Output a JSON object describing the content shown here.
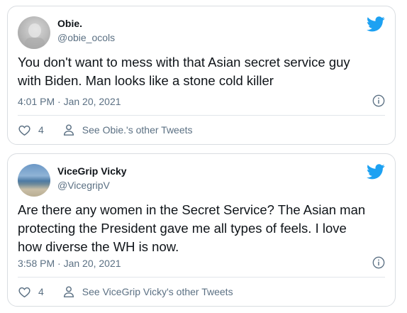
{
  "colors": {
    "twitter_blue": "#1da1f2",
    "secondary_text": "#5b7083",
    "border": "#d9dde1"
  },
  "tweets": [
    {
      "name": "Obie.",
      "handle": "@obie_ocols",
      "text": "You don't want to mess with that Asian secret service guy\nwith Biden. Man looks like a stone cold killer",
      "time": "4:01 PM · Jan 20, 2021",
      "likes": "4",
      "profile_link": "See Obie.'s other Tweets",
      "icons": {
        "brand": "twitter-bird-icon",
        "info": "info-icon",
        "like": "heart-icon",
        "profile": "person-icon"
      }
    },
    {
      "name": "ViceGrip Vicky",
      "handle": "@VicegripV",
      "text": "Are there any women in the Secret Service? The Asian man\nprotecting the President gave me all types of feels. I love\nhow diverse the WH is now.",
      "time": "3:58 PM · Jan 20, 2021",
      "likes": "4",
      "profile_link": "See ViceGrip Vicky's other Tweets",
      "icons": {
        "brand": "twitter-bird-icon",
        "info": "info-icon",
        "like": "heart-icon",
        "profile": "person-icon"
      }
    }
  ]
}
